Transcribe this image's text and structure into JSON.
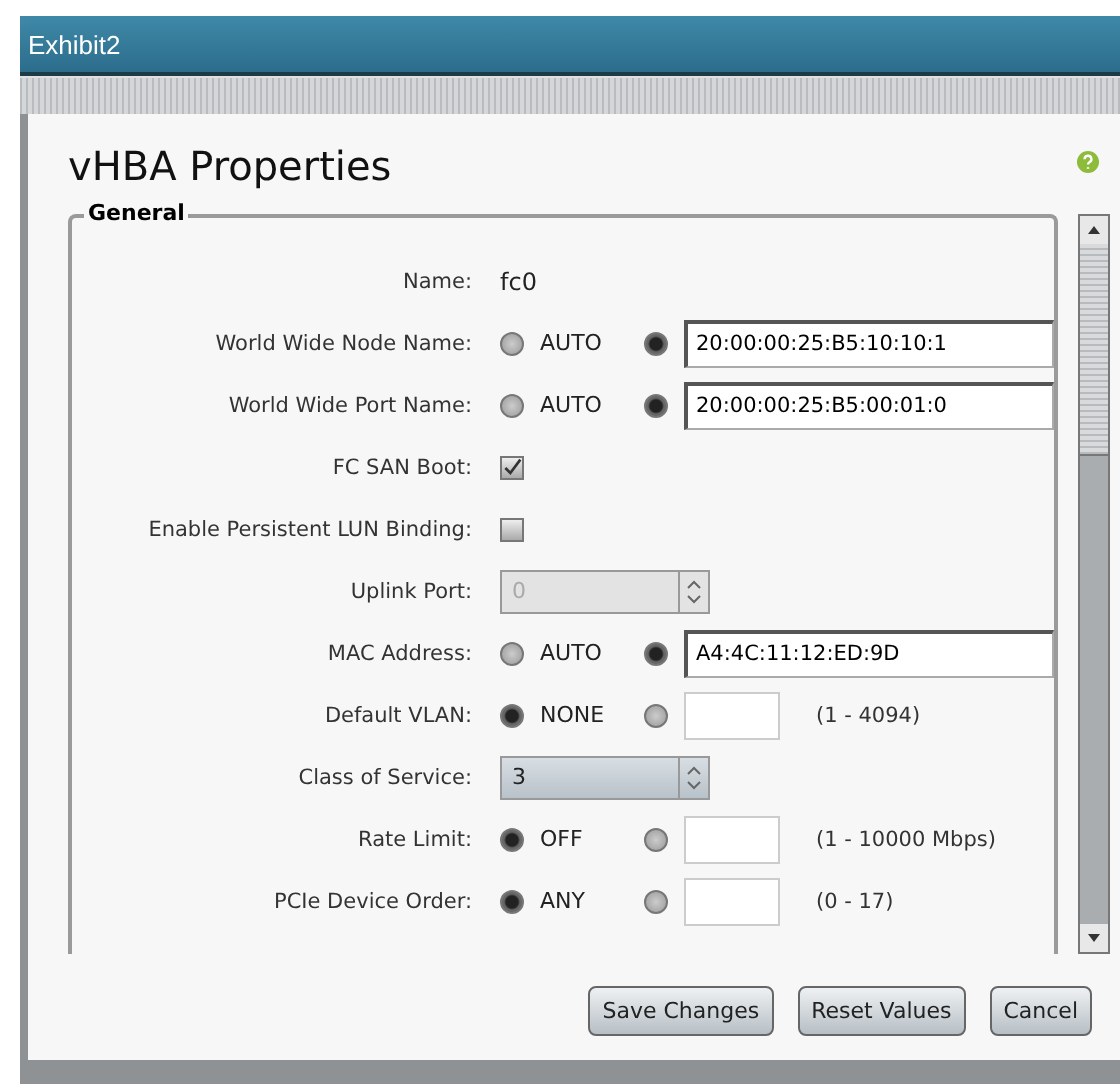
{
  "window": {
    "title": "Exhibit2"
  },
  "dialog": {
    "title": "vHBA Properties",
    "section": "General",
    "fields": [
      {
        "kind": "text",
        "label": "Name:",
        "value": "fc0"
      },
      {
        "kind": "choice",
        "label": "World Wide Node Name:",
        "default_option": {
          "label": "AUTO",
          "selected": false
        },
        "custom_option": {
          "selected": true,
          "value": "20:00:00:25:B5:10:10:1"
        }
      },
      {
        "kind": "choice",
        "label": "World Wide Port Name:",
        "default_option": {
          "label": "AUTO",
          "selected": false
        },
        "custom_option": {
          "selected": true,
          "value": "20:00:00:25:B5:00:01:0"
        }
      },
      {
        "kind": "checkbox",
        "label": "FC SAN Boot:",
        "checked": true
      },
      {
        "kind": "checkbox",
        "label": "Enable Persistent LUN Binding:",
        "checked": false
      },
      {
        "kind": "select",
        "label": "Uplink Port:",
        "value": "0",
        "disabled": true
      },
      {
        "kind": "choice",
        "label": "MAC Address:",
        "default_option": {
          "label": "AUTO",
          "selected": false
        },
        "custom_option": {
          "selected": true,
          "value": "A4:4C:11:12:ED:9D"
        }
      },
      {
        "kind": "choice",
        "label": "Default VLAN:",
        "default_option": {
          "label": "NONE",
          "selected": true
        },
        "custom_option": {
          "selected": false
        },
        "range": "(1 - 4094)"
      },
      {
        "kind": "select",
        "label": "Class of Service:",
        "value": "3",
        "disabled": false
      },
      {
        "kind": "choice",
        "label": "Rate Limit:",
        "default_option": {
          "label": "OFF",
          "selected": true
        },
        "custom_option": {
          "selected": false
        },
        "range": "(1 - 10000 Mbps)"
      },
      {
        "kind": "choice",
        "label": "PCIe Device Order:",
        "default_option": {
          "label": "ANY",
          "selected": true
        },
        "custom_option": {
          "selected": false
        },
        "range": "(0 - 17)"
      }
    ],
    "buttons": [
      "Save Changes",
      "Reset Values",
      "Cancel"
    ]
  }
}
